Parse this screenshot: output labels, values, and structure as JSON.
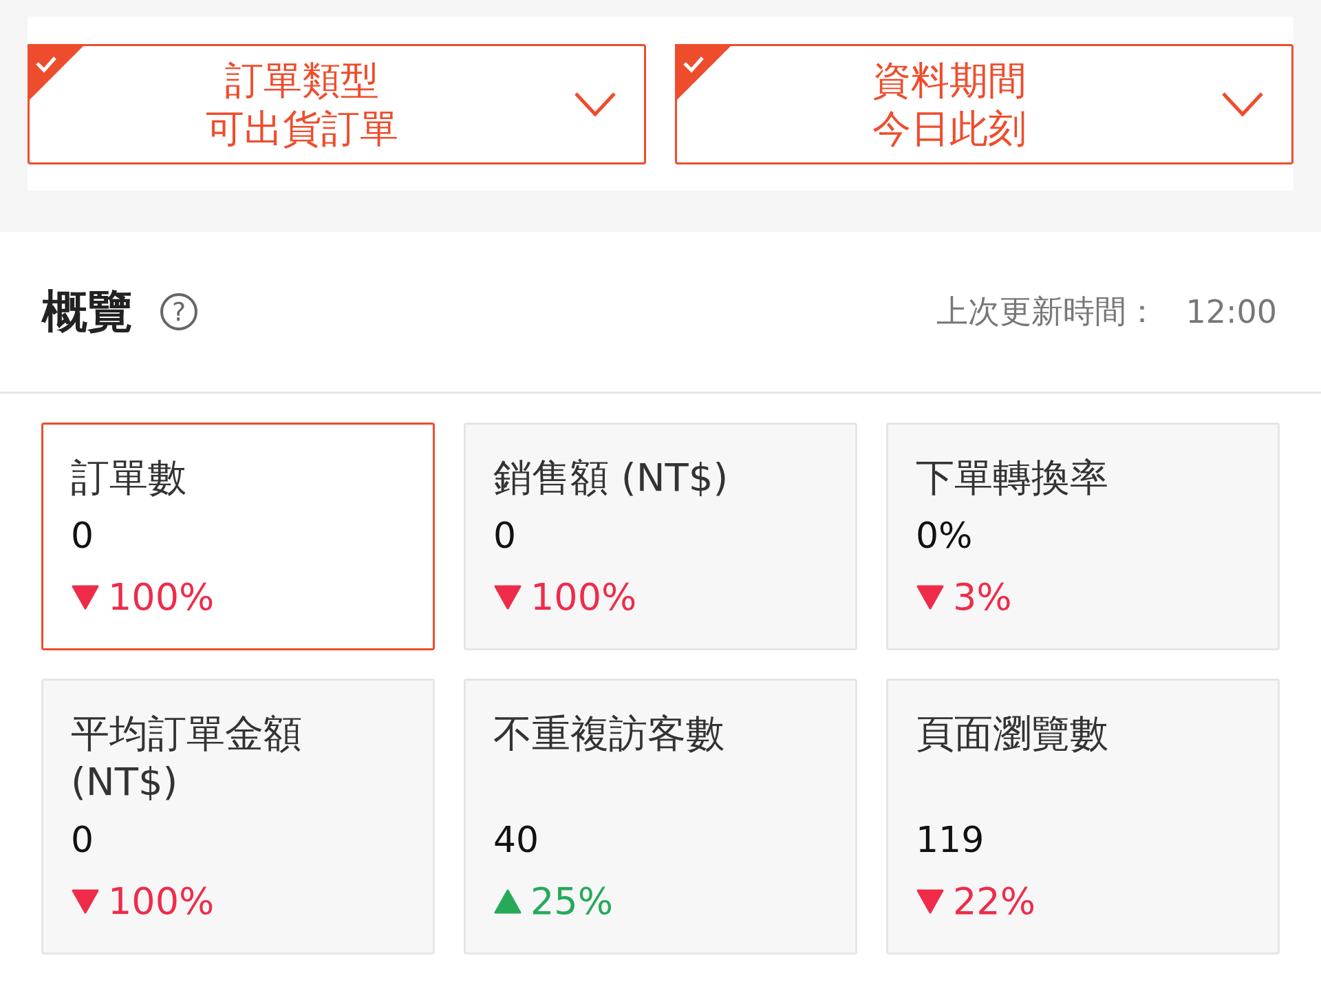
{
  "filters": [
    {
      "title": "訂單類型",
      "value": "可出貨訂單",
      "checked": true
    },
    {
      "title": "資料期間",
      "value": "今日此刻",
      "checked": true
    }
  ],
  "overview": {
    "title": "概覽",
    "help": "?",
    "updated_label": "上次更新時間：",
    "updated_time": "12:00"
  },
  "cards": [
    {
      "label": "訂單數",
      "value": "0",
      "change": "100%",
      "kind": "down",
      "selected": true
    },
    {
      "label": "銷售額 (NT$)",
      "value": "0",
      "change": "100%",
      "kind": "down",
      "selected": false
    },
    {
      "label": "下單轉換率",
      "value": "0%",
      "change": "3%",
      "kind": "down",
      "selected": false
    },
    {
      "label": "平均訂單金額 (NT$)",
      "value": "0",
      "change": "100%",
      "kind": "down",
      "selected": false
    },
    {
      "label": "不重複訪客數",
      "value": "40",
      "change": "25%",
      "kind": "up",
      "selected": false
    },
    {
      "label": "頁面瀏覽數",
      "value": "119",
      "change": "22%",
      "kind": "down",
      "selected": false
    }
  ]
}
